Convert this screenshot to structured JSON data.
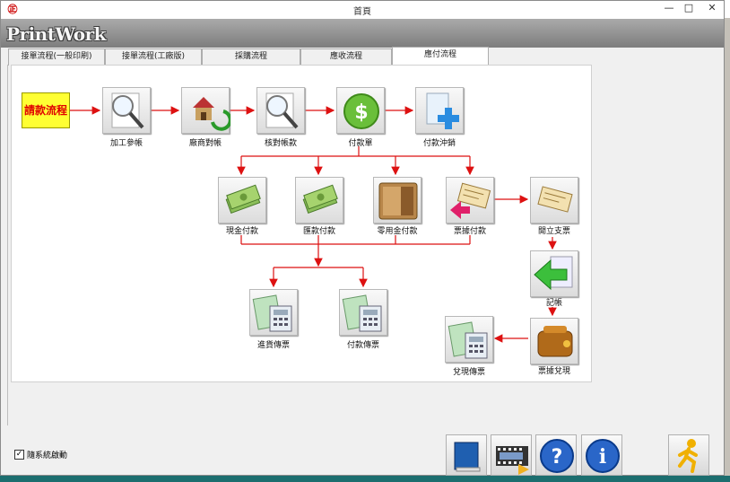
{
  "window": {
    "title": "首頁",
    "min": "—",
    "max": "□",
    "close": "✕"
  },
  "brand": "PrintWork",
  "tabs": [
    {
      "label": "接單流程(一般印刷)"
    },
    {
      "label": "接單流程(工廠版)"
    },
    {
      "label": "採購流程"
    },
    {
      "label": "應收流程"
    },
    {
      "label": "應付流程",
      "active": true
    }
  ],
  "flow": {
    "start": "請款流程",
    "nodes": {
      "n1": "加工參帳",
      "n2": "廠商對帳",
      "n3": "核對帳款",
      "n4": "付款單",
      "n5": "付款沖銷",
      "p1": "現金付款",
      "p2": "匯款付款",
      "p3": "零用金付款",
      "p4": "票據付款",
      "r1": "開立支票",
      "r2": "記帳",
      "r3": "票據兌現",
      "v1": "進貨傳票",
      "v2": "付款傳票",
      "v3": "兌現傳票"
    }
  },
  "footer": {
    "checkbox_label": "隨系統啟動",
    "checked": "✓"
  },
  "icons": {
    "book": "book-icon",
    "film": "film-icon",
    "help": "help-icon",
    "info": "info-icon",
    "run": "running-man-icon"
  }
}
